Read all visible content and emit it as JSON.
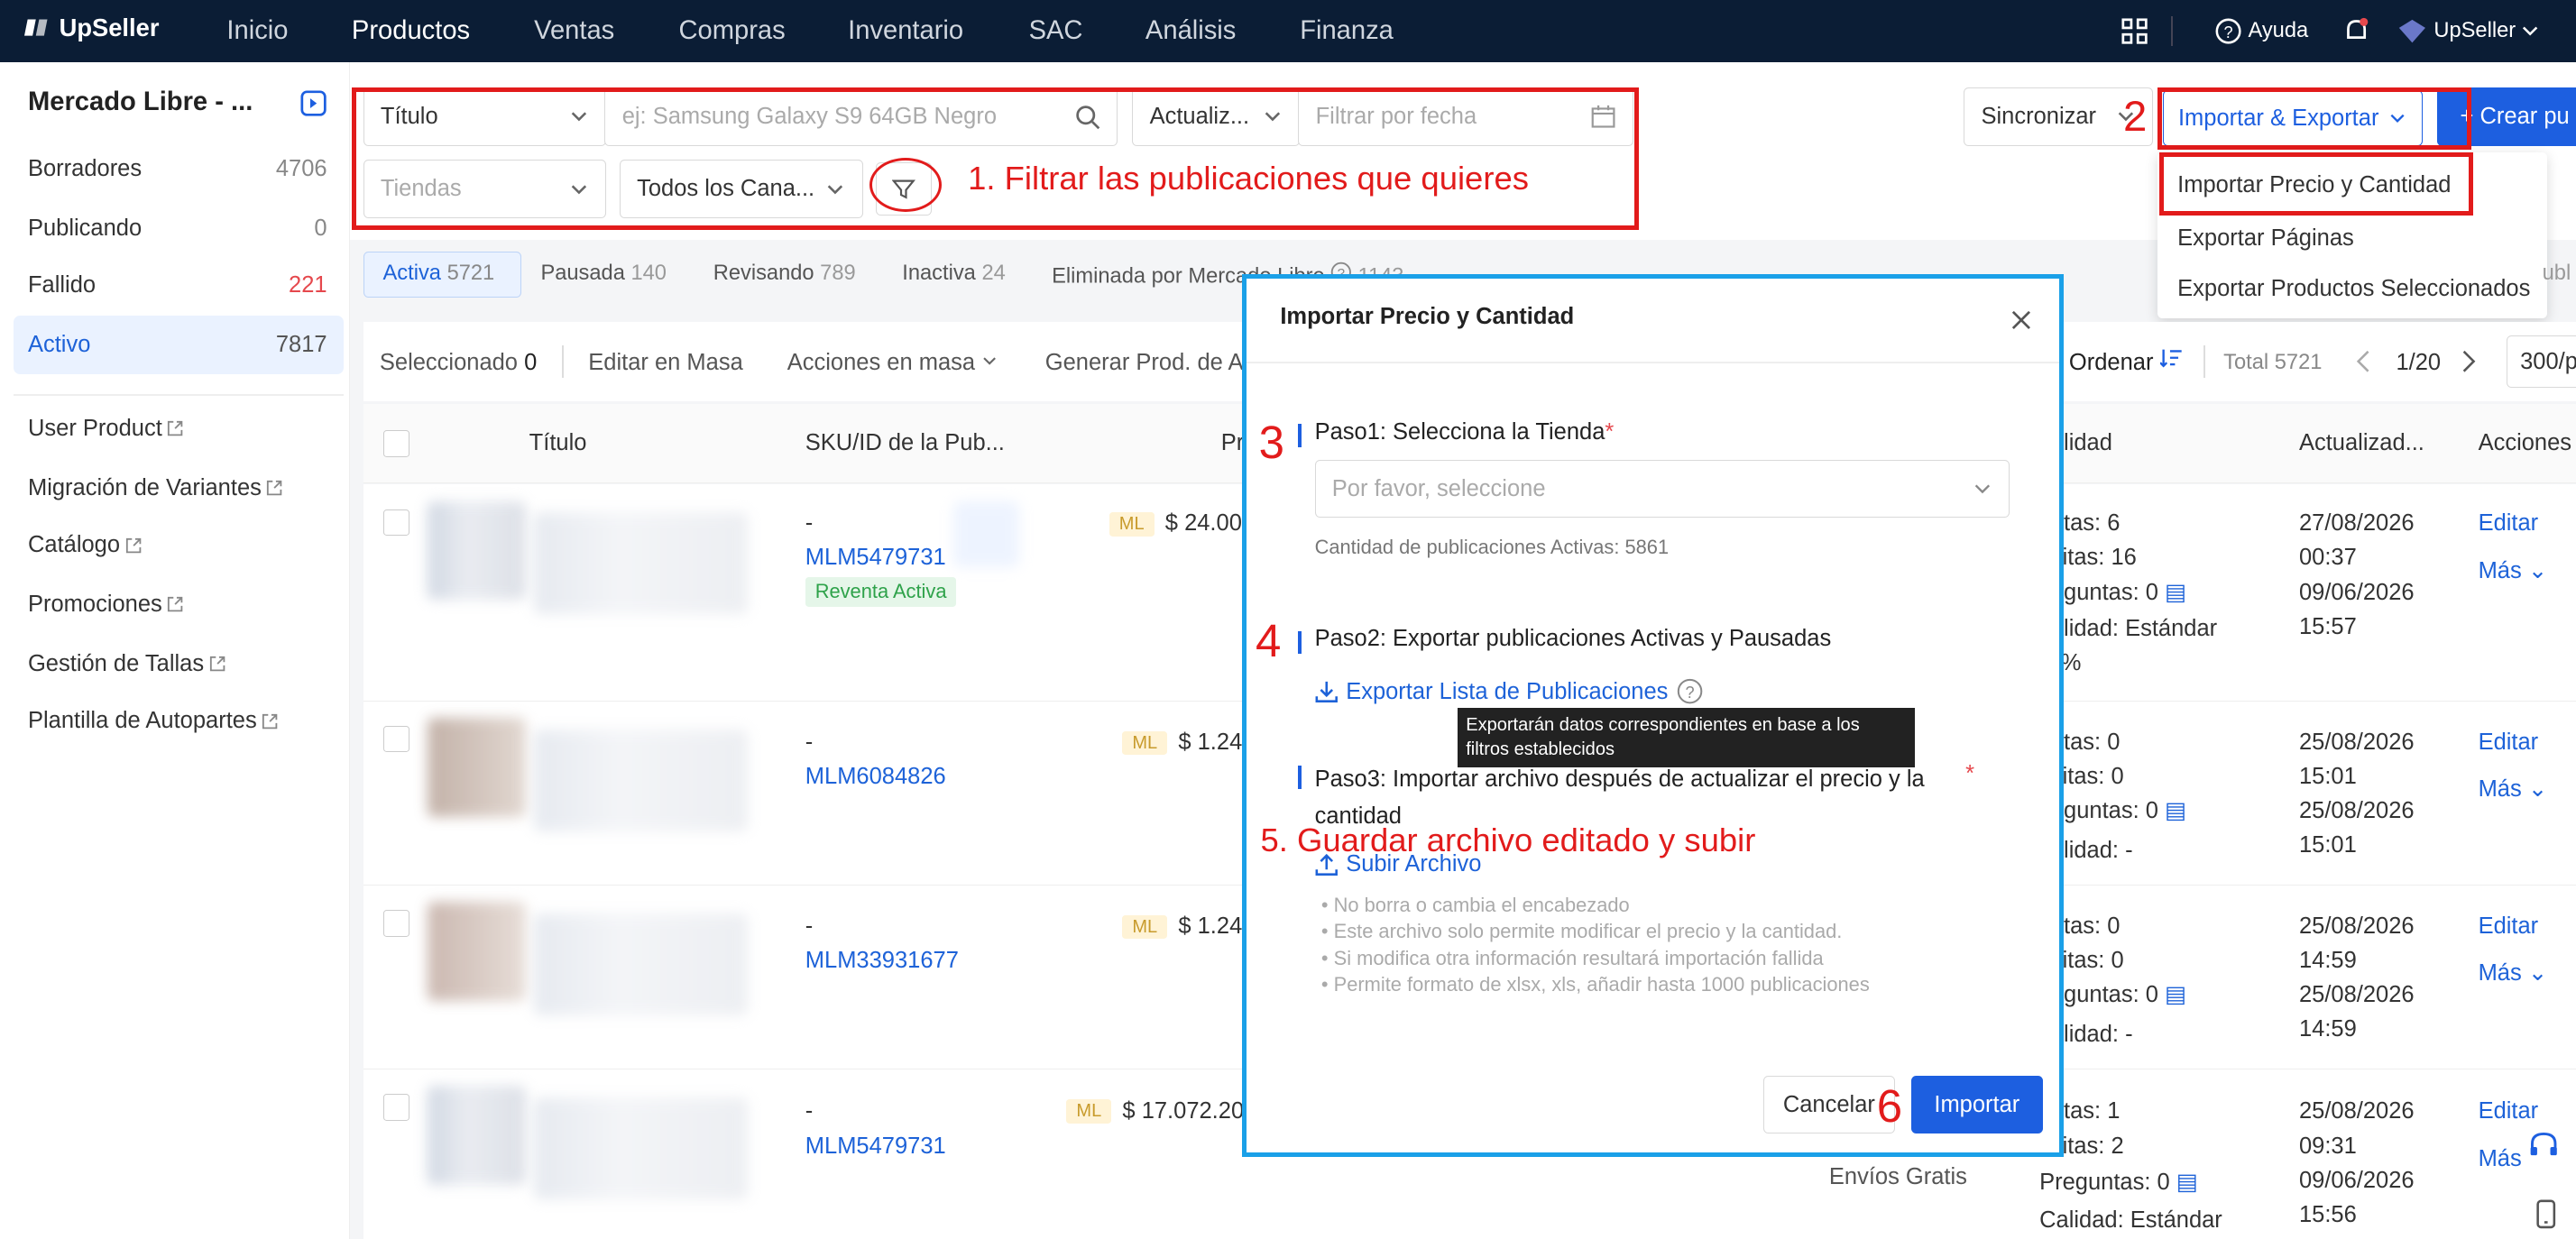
{
  "app": {
    "brand": "UpSeller"
  },
  "topnav": {
    "items": [
      "Inicio",
      "Productos",
      "Ventas",
      "Compras",
      "Inventario",
      "SAC",
      "Análisis",
      "Finanza"
    ],
    "help": "Ayuda",
    "user": "UpSeller"
  },
  "sidebar": {
    "title": "Mercado Libre - ...",
    "status": [
      {
        "label": "Borradores",
        "count": "4706"
      },
      {
        "label": "Publicando",
        "count": "0"
      },
      {
        "label": "Fallido",
        "count": "221"
      },
      {
        "label": "Activo",
        "count": "7817"
      }
    ],
    "links": [
      "User Product",
      "Migración de Variantes",
      "Catálogo",
      "Promociones",
      "Gestión de Tallas",
      "Plantilla de Autopartes"
    ]
  },
  "filters": {
    "title_select": "Título",
    "search_placeholder": "ej: Samsung Galaxy S9 64GB Negro",
    "date_select": "Actualiz...",
    "date_placeholder": "Filtrar por fecha",
    "stores_placeholder": "Tiendas",
    "channels": "Todos los Cana..."
  },
  "toolbar": {
    "sync": "Sincronizar",
    "import_export": "Importar & Exportar",
    "create": "+ Crear pu"
  },
  "dropdown": {
    "items": [
      "Importar Precio y Cantidad",
      "Exportar Páginas",
      "Exportar Productos Seleccionados"
    ]
  },
  "tabs": [
    {
      "label": "Activa",
      "count": "5721"
    },
    {
      "label": "Pausada",
      "count": "140"
    },
    {
      "label": "Revisando",
      "count": "789"
    },
    {
      "label": "Inactiva",
      "count": "24"
    },
    {
      "label": "Eliminada por Mercado Libre",
      "count": "1143"
    }
  ],
  "tabs_tail": "ubl",
  "actionbar": {
    "selected": "Seleccionado",
    "selected_count": "0",
    "bulk_edit": "Editar en Masa",
    "bulk_actions": "Acciones en masa",
    "generate": "Generar Prod. de A",
    "sort": "Ordenar",
    "total": "Total 5721",
    "page": "1/20",
    "per_page": "300/p"
  },
  "table": {
    "headers": {
      "title": "Título",
      "sku": "SKU/ID de la Pub...",
      "price": "Pr",
      "quality": "alidad",
      "updated": "Actualizad...",
      "actions": "Acciones"
    },
    "rows": [
      {
        "dash": "-",
        "id": "MLM5479731",
        "tag": "Reventa Activa",
        "ml": "ML",
        "price": "$ 24.00",
        "q1": "ntas: 6",
        "q2": "sitas: 16",
        "q3": "eguntas: 0",
        "q4": "alidad: Estándar",
        "q5": "%",
        "d1": "27/08/2026",
        "d2": "00:37",
        "d3": "09/06/2026",
        "d4": "15:57",
        "edit": "Editar",
        "more": "Más"
      },
      {
        "dash": "-",
        "id": "MLM6084826",
        "ml": "ML",
        "price": "$ 1.24",
        "q1": "ntas: 0",
        "q2": "sitas: 0",
        "q3": "eguntas: 0",
        "q4": "alidad: -",
        "d1": "25/08/2026",
        "d2": "15:01",
        "d3": "25/08/2026",
        "d4": "15:01",
        "edit": "Editar",
        "more": "Más"
      },
      {
        "dash": "-",
        "id": "MLM33931677",
        "ml": "ML",
        "price": "$ 1.24",
        "q1": "ntas: 0",
        "q2": "sitas: 0",
        "q3": "eguntas: 0",
        "q4": "alidad: -",
        "d1": "25/08/2026",
        "d2": "14:59",
        "d3": "25/08/2026",
        "d4": "14:59",
        "edit": "Editar",
        "more": "Más"
      },
      {
        "dash": "-",
        "id": "MLM5479731",
        "ml": "ML",
        "price": "$ 17.072.20",
        "q1": "ntas: 1",
        "q2": "sitas: 2",
        "q3": "Preguntas: 0",
        "q4": "Calidad: Estándar",
        "shipping": "Envíos Gratis",
        "d1": "25/08/2026",
        "d2": "09:31",
        "d3": "09/06/2026",
        "d4": "15:56",
        "edit": "Editar",
        "more": "Más"
      }
    ]
  },
  "modal": {
    "title": "Importar Precio y Cantidad",
    "step1": "Paso1: Selecciona la Tienda",
    "step1_placeholder": "Por favor, seleccione",
    "step1_note": "Cantidad de publicaciones Activas: 5861",
    "step2": "Paso2: Exportar publicaciones Activas y Pausadas",
    "export_link": "Exportar Lista de Publicaciones",
    "tooltip": "Exportarán datos correspondientes en base a los filtros establecidos",
    "step3_line1": "Paso3: Importar archivo después de actualizar el precio y la",
    "step3_line2": "cantidad",
    "upload": "Subir Archivo",
    "notes": [
      "No borra o cambia el encabezado",
      "Este archivo solo permite modificar el precio y la cantidad.",
      "Si modifica otra información resultará importación fallida",
      "Permite formato de xlsx, xls, añadir hasta 1000 publicaciones"
    ],
    "cancel": "Cancelar",
    "import": "Importar"
  },
  "annotations": {
    "a1": "1. Filtrar las publicaciones que quieres",
    "a2": "2",
    "a3": "3",
    "a4": "4",
    "a5": "5. Guardar archivo editado y subir",
    "a6": "6"
  },
  "colors": {
    "nav_bg": "#0b1d35",
    "primary": "#1d5fe0",
    "annotation": "#e21b1b",
    "highlight": "#1aa0e8",
    "danger_count": "#e5484d"
  }
}
